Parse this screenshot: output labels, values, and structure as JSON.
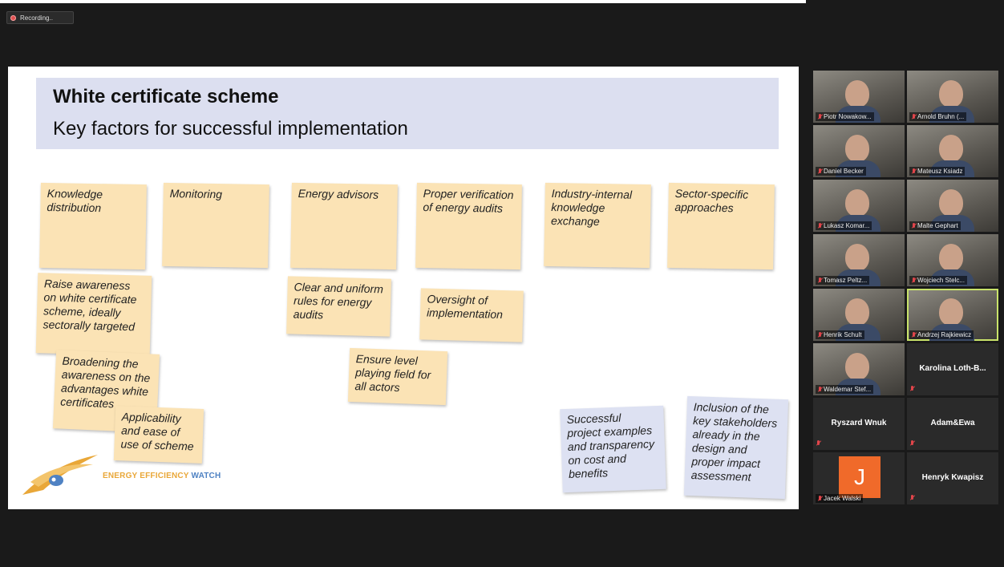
{
  "recording": {
    "label": "Recording..",
    "icon": "record-icon"
  },
  "slide": {
    "title": "White certificate scheme",
    "subtitle": "Key factors for successful implementation",
    "notes": [
      "Knowledge distribution",
      "Monitoring",
      "Energy advisors",
      "Proper verification of energy audits",
      "Industry-internal knowledge exchange",
      "Sector-specific approaches",
      "Raise awareness on white certificate scheme, ideally sectorally targeted",
      "Clear and uniform rules for energy audits",
      "Oversight of implementation",
      "Broadening the awareness on the advantages white certificates",
      "Ensure level playing field for all actors",
      "Applicability and ease of use of scheme",
      "Successful project examples and transparency on cost and benefits",
      "Inclusion of the key stakeholders already in the design and proper impact assessment"
    ],
    "logo": {
      "part1": "ENERGY EFFICIENCY",
      "part2": "WATCH"
    }
  },
  "participants": [
    {
      "name": "Piotr Nowakow...",
      "video": true
    },
    {
      "name": "Arnold Bruhn (...",
      "video": true
    },
    {
      "name": "Daniel Becker",
      "video": true
    },
    {
      "name": "Mateusz Ksiadz",
      "video": true
    },
    {
      "name": "Lukasz Komar...",
      "video": true
    },
    {
      "name": "Malte Gephart",
      "video": true
    },
    {
      "name": "Tomasz Peltz...",
      "video": true
    },
    {
      "name": "Wojciech Stelc...",
      "video": true
    },
    {
      "name": "Henrik Schult",
      "video": true
    },
    {
      "name": "Andrzej Rajkiewicz",
      "video": true,
      "active": true
    },
    {
      "name": "Waldemar Stef...",
      "video": true
    },
    {
      "name": "Karolina  Loth-B...",
      "video": false
    },
    {
      "name": "Ryszard Wnuk",
      "video": false
    },
    {
      "name": "Adam&Ewa",
      "video": false
    },
    {
      "name": "Jacek Walski",
      "video": false,
      "avatar": "J"
    },
    {
      "name": "Henryk Kwapisz",
      "video": false
    }
  ],
  "colors": {
    "sticky": "#fbe3b5",
    "sticky_blue": "#dde1f2",
    "title_band": "#dcdff0",
    "active_speaker": "#c9e36a"
  }
}
